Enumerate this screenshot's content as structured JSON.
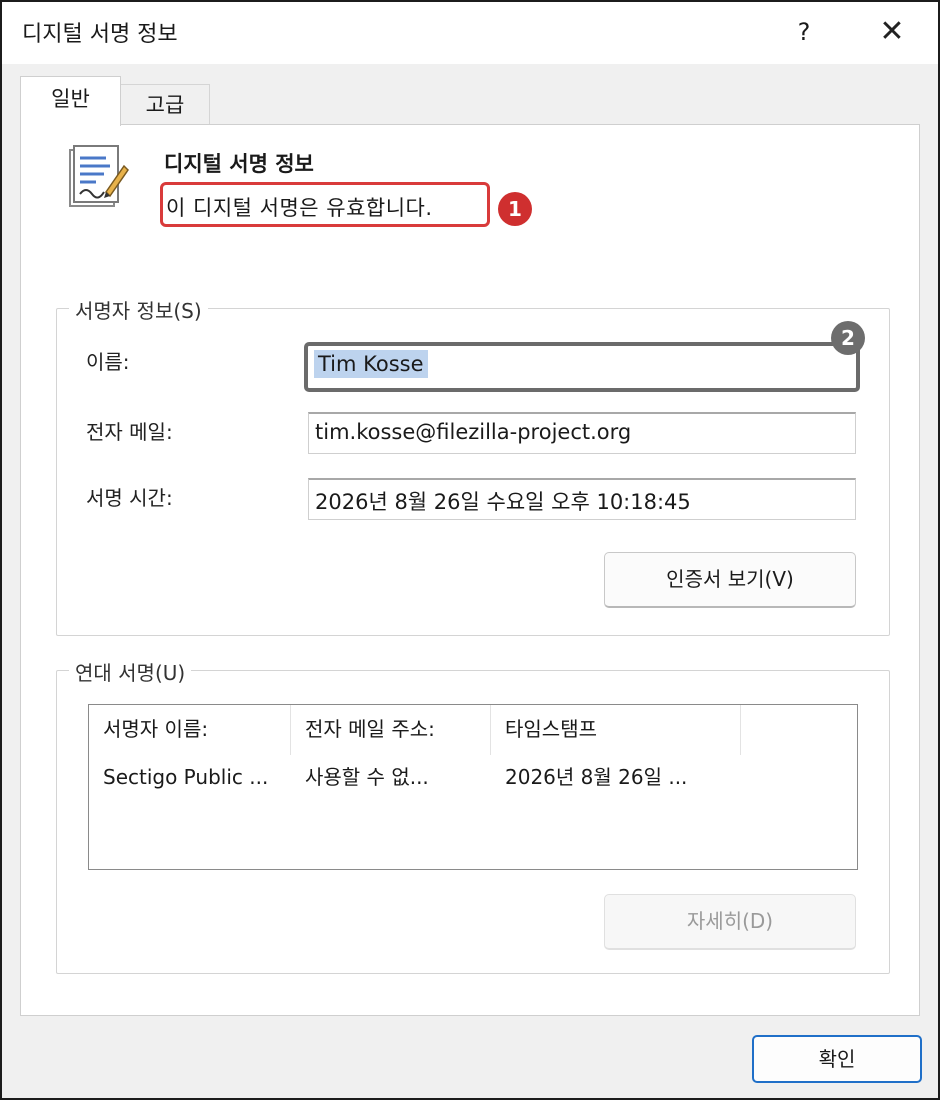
{
  "window": {
    "title": "디지털 서명 정보",
    "help": "?",
    "close": "✕"
  },
  "tabs": [
    {
      "label": "일반",
      "selected": true
    },
    {
      "label": "고급",
      "selected": false
    }
  ],
  "header": {
    "title": "디지털 서명 정보",
    "status": "이 디지털 서명은 유효합니다.",
    "icon": "signed-document-icon"
  },
  "annotations": {
    "badge1": "1",
    "badge2": "2"
  },
  "signer": {
    "legend": "서명자 정보(S)",
    "name_label": "이름:",
    "name_value": "Tim Kosse",
    "email_label": "전자 메일:",
    "email_value": "tim.kosse@filezilla-project.org",
    "time_label": "서명 시간:",
    "time_value": "2026년 8월 26일 수요일 오후 10:18:45",
    "view_cert_button": "인증서 보기(V)"
  },
  "countersignatures": {
    "legend": "연대 서명(U)",
    "columns": [
      "서명자 이름:",
      "전자 메일 주소:",
      "타임스탬프"
    ],
    "rows": [
      [
        "Sectigo Public ...",
        "사용할 수 없...",
        "2026년 8월 26일 ..."
      ]
    ],
    "details_button": "자세히(D)"
  },
  "footer": {
    "ok_button": "확인"
  },
  "colors": {
    "annotation_red": "#d93b3b",
    "annotation_gray": "#6b6b6b",
    "selection": "#bdd3ee",
    "accent": "#1f6fc8"
  }
}
